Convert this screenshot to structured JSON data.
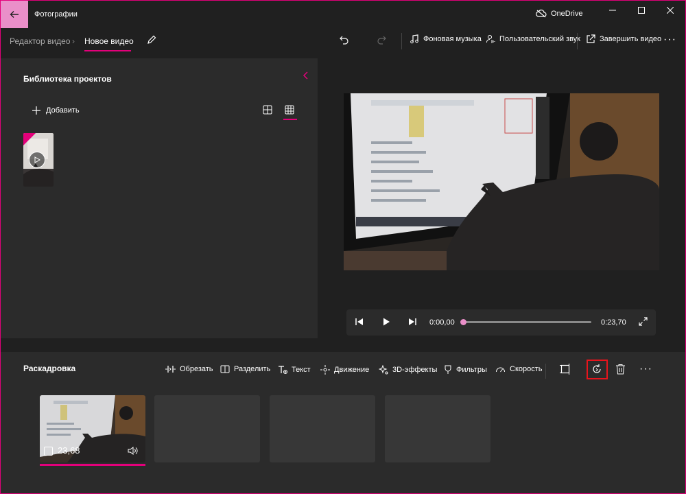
{
  "window": {
    "app_title": "Фотографии",
    "cloud_label": "OneDrive"
  },
  "toolbar": {
    "breadcrumb_parent": "Редактор видео",
    "breadcrumb_current": "Новое видео",
    "music_label": "Фоновая музыка",
    "custom_audio_label": "Пользовательский звук",
    "finish_label": "Завершить видео"
  },
  "library": {
    "title": "Библиотека проектов",
    "add_label": "Добавить"
  },
  "player": {
    "current_time": "0:00,00",
    "total_time": "0:23,70",
    "progress": 0
  },
  "storyboard": {
    "title": "Раскадровка",
    "tools": {
      "trim": "Обрезать",
      "split": "Разделить",
      "text": "Текст",
      "motion": "Движение",
      "effects3d": "3D-эффекты",
      "filters": "Фильтры",
      "speed": "Скорость"
    },
    "clips": [
      {
        "duration": "23,68"
      }
    ]
  },
  "colors": {
    "accent": "#e3007a",
    "accent_light": "#ea8fc9",
    "highlight_box": "#e8141c",
    "panel": "#2b2b2b",
    "background": "#202020"
  }
}
